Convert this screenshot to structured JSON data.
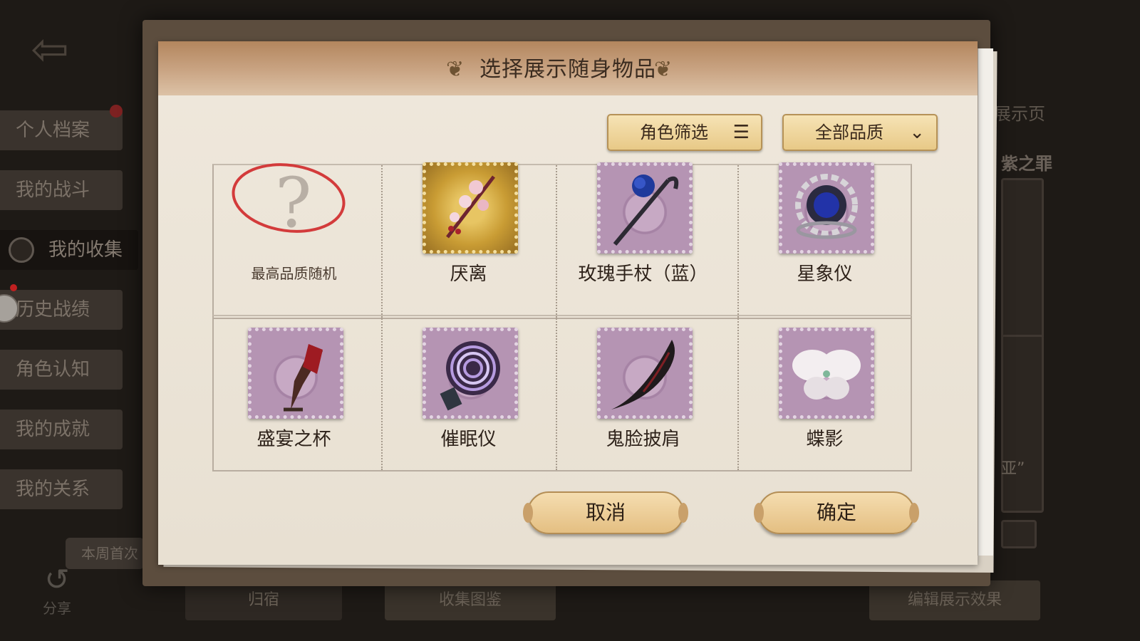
{
  "background": {
    "sidebar": {
      "items": [
        {
          "label": "个人档案"
        },
        {
          "label": "我的战斗"
        },
        {
          "label": "我的收集"
        },
        {
          "label": "历史战绩"
        },
        {
          "label": "角色认知"
        },
        {
          "label": "我的成就"
        },
        {
          "label": "我的关系"
        }
      ],
      "active_index": 2
    },
    "weekly_tag": "本周首次",
    "share_label": "分享",
    "bottom_bar": {
      "home_label": "归宿",
      "collection_label": "收集图鉴",
      "edit_label": "编辑展示效果"
    },
    "right_panel": {
      "header": "展示页",
      "name": "紫之罪",
      "quote": "亚”"
    }
  },
  "modal": {
    "title": "选择展示随身物品",
    "filters": {
      "character_filter_label": "角色筛选",
      "quality_filter_label": "全部品质"
    },
    "items": [
      {
        "label": "最高品质随机",
        "stamp": "mystery"
      },
      {
        "label": "厌离",
        "stamp": "gold"
      },
      {
        "label": "玫瑰手杖（蓝）",
        "stamp": "purple"
      },
      {
        "label": "星象仪",
        "stamp": "purple"
      },
      {
        "label": "盛宴之杯",
        "stamp": "purple"
      },
      {
        "label": "催眠仪",
        "stamp": "purple"
      },
      {
        "label": "鬼脸披肩",
        "stamp": "purple"
      },
      {
        "label": "蝶影",
        "stamp": "purple"
      }
    ],
    "cancel_label": "取消",
    "confirm_label": "确定"
  },
  "colors": {
    "gold_stamp": "#c99c34",
    "purple_stamp": "#b594b3",
    "button_gold": "#e8c987",
    "header_brown": "#b3865e",
    "mystery_circle": "#d33b3b"
  },
  "icons": {
    "back": "back-door-icon",
    "filter_list": "list-icon",
    "quality_dropdown": "chevron-down-icon",
    "share": "share-icon"
  }
}
